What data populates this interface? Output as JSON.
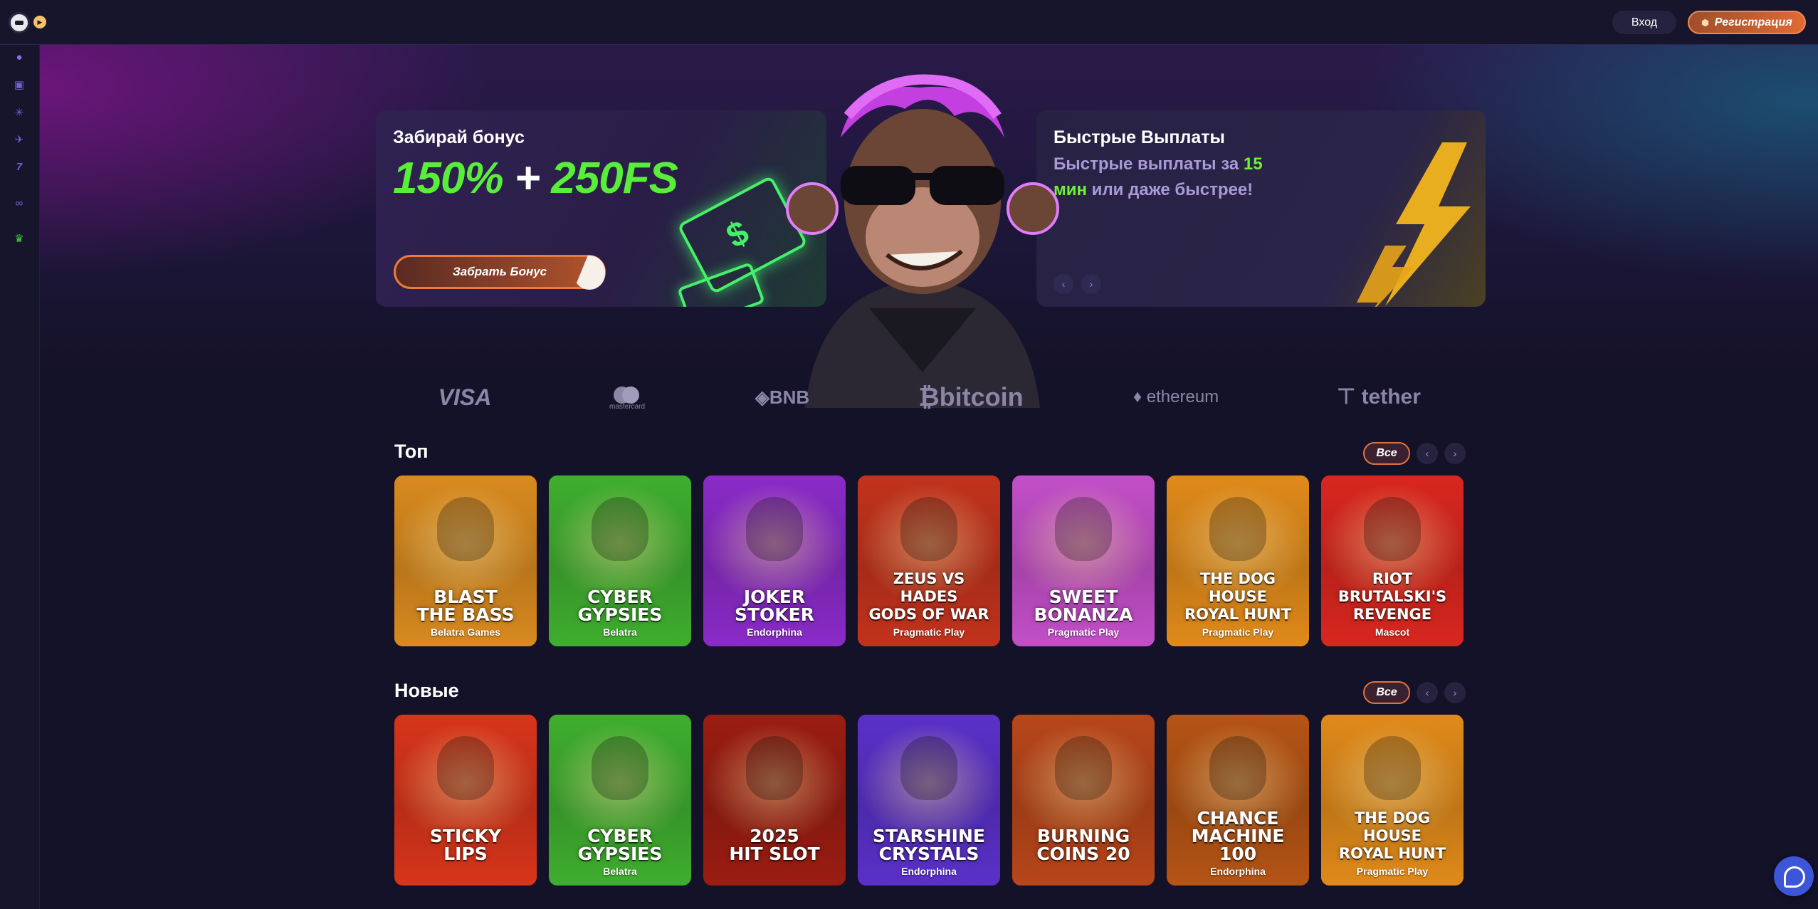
{
  "header": {
    "login_label": "Вход",
    "register_label": "Регистрация"
  },
  "sidebar": {
    "items": [
      {
        "icon": "poker-chip-icon"
      },
      {
        "icon": "slot-machine-icon"
      },
      {
        "icon": "sparkle-icon"
      },
      {
        "icon": "plane-icon"
      },
      {
        "icon": "lucky-seven-icon"
      },
      {
        "icon": "link-icon"
      },
      {
        "icon": "trophy-icon"
      }
    ]
  },
  "promo": {
    "bonus": {
      "title": "Забирай бонус",
      "amount_main": "150%",
      "amount_plus": "+",
      "amount_fs": "250FS",
      "button_label": "Забрать Бонус"
    },
    "payouts": {
      "title": "Быстрые Выплаты",
      "text_before": "Быстрые выплаты за ",
      "text_highlight": "15 мин",
      "text_after": " или даже быстрее!"
    }
  },
  "payment_methods": [
    "VISA",
    "mastercard",
    "BNB",
    "bitcoin",
    "ethereum",
    "tether"
  ],
  "sections": [
    {
      "title": "Топ",
      "all_label": "Все",
      "games": [
        {
          "name": "BLAST\nTHE BASS",
          "provider": "Belatra Games",
          "bg": "#d98a1f"
        },
        {
          "name": "CYBER\nGYPSIES",
          "provider": "Belatra",
          "bg": "#3fae2f"
        },
        {
          "name": "JOKER\nSTOKER",
          "provider": "Endorphina",
          "bg": "#8a2bc8"
        },
        {
          "name": "ZEUS VS HADES\nGODS OF WAR",
          "provider": "Pragmatic Play",
          "bg": "#c2331d"
        },
        {
          "name": "SWEET\nBONANZA",
          "provider": "Pragmatic Play",
          "bg": "#c34fc8"
        },
        {
          "name": "THE DOG HOUSE\nROYAL HUNT",
          "provider": "Pragmatic Play",
          "bg": "#e08a1a"
        },
        {
          "name": "RIOT\nBRUTALSKI'S\nREVENGE",
          "provider": "Mascot",
          "bg": "#d9271f"
        }
      ]
    },
    {
      "title": "Новые",
      "all_label": "Все",
      "games": [
        {
          "name": "STICKY\nLIPS",
          "provider": "",
          "bg": "#d8351b"
        },
        {
          "name": "CYBER\nGYPSIES",
          "provider": "Belatra",
          "bg": "#3fae2f"
        },
        {
          "name": "2025\nHIT SLOT",
          "provider": "",
          "bg": "#9b1d12"
        },
        {
          "name": "STARSHINE\nCRYSTALS",
          "provider": "Endorphina",
          "bg": "#5a31c9"
        },
        {
          "name": "BURNING\nCOINS 20",
          "provider": "",
          "bg": "#b8461a"
        },
        {
          "name": "CHANCE\nMACHINE 100",
          "provider": "Endorphina",
          "bg": "#b55415"
        },
        {
          "name": "THE DOG HOUSE\nROYAL HUNT",
          "provider": "Pragmatic Play",
          "bg": "#e08a1a"
        }
      ]
    }
  ]
}
